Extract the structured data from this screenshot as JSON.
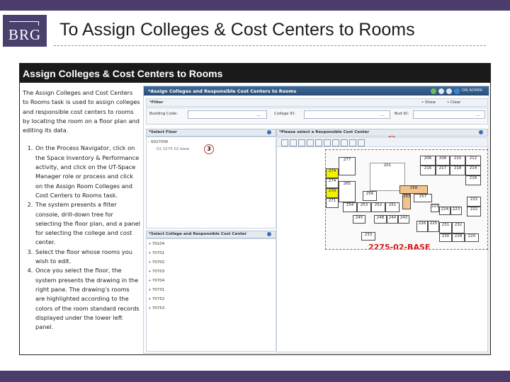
{
  "brand": {
    "logo_text": "BRG"
  },
  "slide": {
    "title": "To Assign Colleges & Cost Centers to Rooms"
  },
  "panel": {
    "title": "Assign Colleges & Cost Centers to Rooms",
    "intro": "The Assign Colleges and Cost Centers to Rooms task is used to assign colleges and responsible cost centers to rooms by locating the room on a floor plan and editing its data.",
    "steps": [
      "On the Process Navigator, click on the Space Inventory & Performance activity, and click on the UT-Space Manager role or process and click on the Assign Room Colleges and Cost Centers to Rooms task.",
      "The system presents a filter console, drill-down tree for selecting the floor plan, and a panel for selecting the college and cost center.",
      "Select the floor whose rooms you wish to edit.",
      "Once you select the floor, the system presents the drawing in the right pane. The drawing's rooms are highlighted according to the colors of the room standard records displayed under the lower left panel."
    ]
  },
  "screenshot": {
    "window_title": "*Assign Colleges and Responsible Cost Centers to Rooms",
    "user_text": "ON ADMIN",
    "filter": {
      "label": "*Filter",
      "show_labels": [
        "• Show",
        "• Clear"
      ],
      "fields": [
        {
          "label": "Building Code:",
          "value": ""
        },
        {
          "label": "College ID:",
          "value": ""
        },
        {
          "label": "Bud ID:",
          "value": ""
        }
      ]
    },
    "select_floor": {
      "title": "*Select Floor",
      "items": [
        "0027000",
        "02 2275 02 base"
      ]
    },
    "select_college": {
      "title": "*Select College and Responsible Cost Center",
      "items": [
        "70104",
        "70701",
        "70702",
        "70703",
        "70704",
        "70731",
        "70752",
        "70753"
      ]
    },
    "drawing": {
      "title": "*Please select a Responsible Cost Center",
      "floor_label": "2275-02-BASE",
      "rooms": [
        "206",
        "208",
        "210",
        "212",
        "277",
        "216",
        "217",
        "218",
        "274",
        "201",
        "214",
        "274",
        "265",
        "216",
        "270",
        "256",
        "258",
        "263",
        "257",
        "222",
        "271",
        "254",
        "253",
        "252",
        "251",
        "248",
        "245",
        "244",
        "243",
        "222",
        "224",
        "223",
        "221",
        "225",
        "226",
        "231",
        "232",
        "230",
        "228",
        "220",
        "233"
      ]
    },
    "callouts": [
      "3",
      "4"
    ]
  },
  "colors": {
    "header_bar": "#4a3c6b",
    "panel_head": "#1a1a1a",
    "room_yellow": "#f5ef00",
    "room_orange": "#f3c38c",
    "plan_label": "#d21b1b",
    "callout_ring": "#c0392b"
  }
}
